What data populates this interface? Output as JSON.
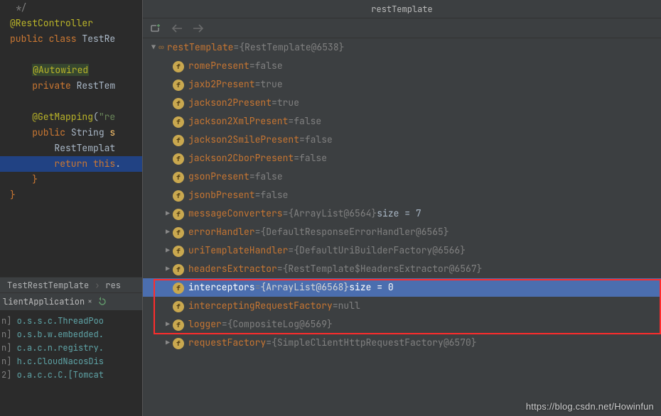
{
  "editor": {
    "lines": [
      {
        "html": " <span class='cmt'>*/</span>"
      },
      {
        "html": "<span class='ann'>@RestController</span>"
      },
      {
        "html": "<span class='kw'>public class </span><span class='cls'>TestRe</span>"
      },
      {
        "html": ""
      },
      {
        "html": "    <span class='hl-autowired'>@Autowired</span>"
      },
      {
        "html": "    <span class='kw'>private </span><span class='cls'>RestTem</span>"
      },
      {
        "html": ""
      },
      {
        "html": "    <span class='ann'>@GetMapping</span>(<span class='str'>\"re</span>"
      },
      {
        "html": "    <span class='kw'>public </span><span class='cls'>String </span><span class='id'>s</span>"
      },
      {
        "html": "        <span class='cls'>RestTemplat</span>"
      },
      {
        "html": "        <span class='return'>return </span><span class='kw'>this</span>.",
        "selected": true
      },
      {
        "html": "    <span class='kw'>}</span>"
      },
      {
        "html": "<span class='kw'>}</span>"
      }
    ]
  },
  "breadcrumb": {
    "a": "TestRestTemplate",
    "b": "res"
  },
  "tabs": {
    "label": "lientApplication"
  },
  "console": {
    "rows": [
      {
        "ts": "n]",
        "cls": "lg-cyan",
        "txt": " o.s.s.c.ThreadPoo"
      },
      {
        "ts": "n]",
        "cls": "lg-cyan",
        "txt": " o.s.b.w.embedded."
      },
      {
        "ts": "n]",
        "cls": "lg-cyan",
        "txt": " c.a.c.n.registry."
      },
      {
        "ts": "n]",
        "cls": "lg-cyan",
        "txt": " h.c.CloudNacosDis"
      },
      {
        "ts": "2]",
        "cls": "lg-cyan",
        "txt": " o.a.c.c.C.[Tomcat"
      }
    ]
  },
  "debug": {
    "title": "restTemplate",
    "root": {
      "name": "restTemplate",
      "value": "{RestTemplate@6538}"
    },
    "fields": [
      {
        "name": "romePresent",
        "value": "false",
        "arrow": ""
      },
      {
        "name": "jaxb2Present",
        "value": "true",
        "arrow": ""
      },
      {
        "name": "jackson2Present",
        "value": "true",
        "arrow": ""
      },
      {
        "name": "jackson2XmlPresent",
        "value": "false",
        "arrow": ""
      },
      {
        "name": "jackson2SmilePresent",
        "value": "false",
        "arrow": ""
      },
      {
        "name": "jackson2CborPresent",
        "value": "false",
        "arrow": ""
      },
      {
        "name": "gsonPresent",
        "value": "false",
        "arrow": ""
      },
      {
        "name": "jsonbPresent",
        "value": "false",
        "arrow": ""
      },
      {
        "name": "messageConverters",
        "value": "{ArrayList@6564}",
        "size": "  size = 7",
        "arrow": "▶"
      },
      {
        "name": "errorHandler",
        "value": "{DefaultResponseErrorHandler@6565}",
        "arrow": "▶"
      },
      {
        "name": "uriTemplateHandler",
        "value": "{DefaultUriBuilderFactory@6566}",
        "arrow": "▶"
      },
      {
        "name": "headersExtractor",
        "value": "{RestTemplate$HeadersExtractor@6567}",
        "arrow": "▶"
      },
      {
        "name": "interceptors",
        "value": "{ArrayList@6568}",
        "size": "  size = 0",
        "arrow": "",
        "selected": true
      },
      {
        "name": "interceptingRequestFactory",
        "value": "null",
        "arrow": ""
      },
      {
        "name": "logger",
        "value": "{CompositeLog@6569}",
        "arrow": "▶"
      },
      {
        "name": "requestFactory",
        "value": "{SimpleClientHttpRequestFactory@6570}",
        "arrow": "▶"
      }
    ]
  },
  "watermark": "https://blog.csdn.net/Howinfun"
}
